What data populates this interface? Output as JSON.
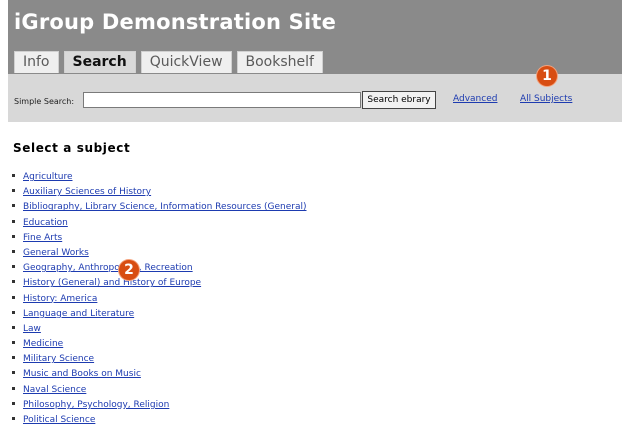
{
  "site": {
    "title": "iGroup Demonstration Site"
  },
  "tabs": [
    {
      "label": "Info",
      "active": false
    },
    {
      "label": "Search",
      "active": true
    },
    {
      "label": "QuickView",
      "active": false
    },
    {
      "label": "Bookshelf",
      "active": false
    }
  ],
  "search": {
    "label": "Simple Search:",
    "value": "",
    "button": "Search ebrary",
    "advanced_link": "Advanced",
    "all_subjects_link": "All Subjects"
  },
  "content": {
    "title": "Select a subject",
    "subjects": [
      "Agriculture",
      "Auxiliary Sciences of History",
      "Bibliography, Library Science, Information Resources (General)",
      "Education",
      "Fine Arts",
      "General Works",
      "Geography, Anthropology, Recreation",
      "History (General) and History of Europe",
      "History: America",
      "Language and Literature",
      "Law",
      "Medicine",
      "Military Science",
      "Music and Books on Music",
      "Naval Science",
      "Philosophy, Psychology, Religion",
      "Political Science"
    ]
  },
  "annotations": [
    {
      "label": "1"
    },
    {
      "label": "2"
    }
  ],
  "colors": {
    "header_bg": "#8a8a8a",
    "searchbar_bg": "#d8d8d8",
    "link": "#1d3bb0",
    "badge": "#d84d12"
  }
}
